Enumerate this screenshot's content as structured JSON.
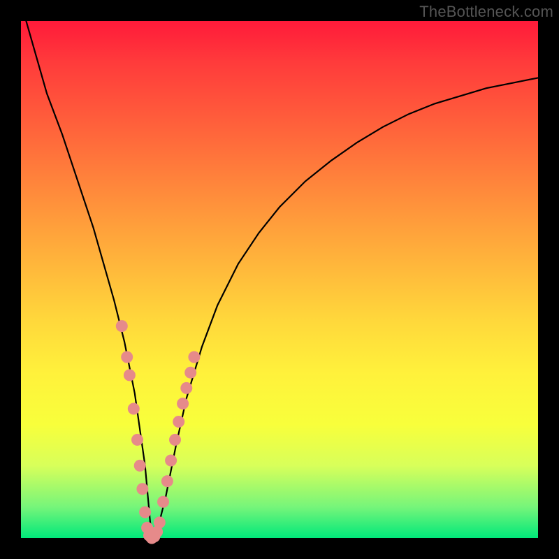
{
  "watermark": "TheBottleneck.com",
  "colors": {
    "frame": "#000000",
    "curve": "#000000",
    "dots": "#e68a8a",
    "gradient_top": "#ff1a3a",
    "gradient_bottom": "#00e87a"
  },
  "chart_data": {
    "type": "line",
    "title": "",
    "xlabel": "",
    "ylabel": "",
    "xlim": [
      0,
      100
    ],
    "ylim": [
      0,
      100
    ],
    "grid": false,
    "legend": false,
    "series": [
      {
        "name": "bottleneck-curve",
        "x": [
          1,
          3,
          5,
          8,
          10,
          12,
          14,
          16,
          18,
          20,
          22,
          24,
          25,
          26,
          28,
          30,
          32,
          35,
          38,
          42,
          46,
          50,
          55,
          60,
          65,
          70,
          75,
          80,
          85,
          90,
          95,
          100
        ],
        "y": [
          100,
          93,
          86,
          78,
          72,
          66,
          60,
          53,
          46,
          38,
          28,
          14,
          3,
          0,
          8,
          18,
          27,
          37,
          45,
          53,
          59,
          64,
          69,
          73,
          76.5,
          79.5,
          82,
          84,
          85.5,
          87,
          88,
          89
        ]
      }
    ],
    "markers": [
      {
        "name": "cluster-left",
        "x": [
          19.5,
          20.5,
          21.0,
          21.8,
          22.5,
          23.0,
          23.5,
          24.0,
          24.4
        ],
        "y": [
          41.0,
          35.0,
          31.5,
          25.0,
          19.0,
          14.0,
          9.5,
          5.0,
          2.0
        ]
      },
      {
        "name": "cluster-bottom",
        "x": [
          24.8,
          25.3,
          25.8,
          26.3,
          26.8
        ],
        "y": [
          0.5,
          0.0,
          0.3,
          1.2,
          3.0
        ]
      },
      {
        "name": "cluster-right",
        "x": [
          27.5,
          28.3,
          29.0,
          29.8,
          30.5,
          31.3,
          32.0,
          32.8,
          33.5
        ],
        "y": [
          7.0,
          11.0,
          15.0,
          19.0,
          22.5,
          26.0,
          29.0,
          32.0,
          35.0
        ]
      }
    ]
  }
}
